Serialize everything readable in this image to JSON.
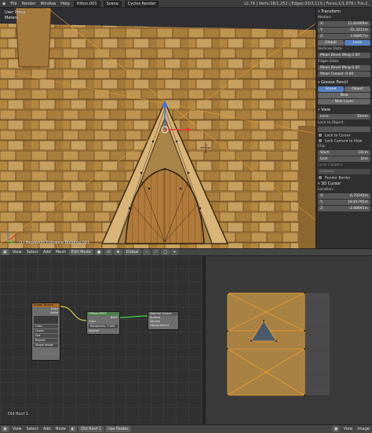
{
  "topbar": {
    "menus": [
      "File",
      "Render",
      "Window",
      "Help"
    ],
    "screen": "Hilton.001",
    "scene": "Scene",
    "engine": "Cycles Render",
    "stats": "v2.76 | Verts:18/1,252 | Edges:30/3,110 | Faces:1/1,878 | Tris:2,"
  },
  "viewport": {
    "view_label": "User Persp",
    "meters_label": "Meters",
    "object_info": "(1) Hepworth Entrance Building.001"
  },
  "npanel": {
    "transform_header": "Transform",
    "median_label": "Median:",
    "median": [
      {
        "axis": "X:",
        "value": "15.84469m"
      },
      {
        "axis": "Y:",
        "value": "-32.3211m"
      },
      {
        "axis": "Z:",
        "value": "3.98857m"
      }
    ],
    "global_btn": "Global",
    "local_btn": "Local",
    "vertices_data": "Vertices Data:",
    "mean_bevel_weight": "Mean Bevel Weig 0.00",
    "edges_data": "Edges Data:",
    "edge_bevel_weight": "Mean Bevel Weig 0.00",
    "mean_crease": "Mean Crease: 0.00",
    "grease_pencil_header": "Grease Pencil",
    "scene_btn": "Scene",
    "object_btn": "Object",
    "new_btn": "New",
    "new_layer_btn": "New Layer",
    "view_header": "View",
    "lens_label": "Lens:",
    "lens_value": "35mm",
    "lock_to_object": "Lock to Object:",
    "lock_to_cursor": "Lock to Cursor",
    "lock_camera_to_view": "Lock Camera to View",
    "clip_label": "Clip:",
    "clip_start_label": "Start:",
    "clip_start_value": "10cm",
    "clip_end_label": "End:",
    "clip_end_value": "1km",
    "local_camera": "Local Camera:",
    "camera_field": "Camera",
    "render_border": "Render Border",
    "cursor_header": "3D Cursor",
    "location_label": "Location:",
    "cursor": [
      {
        "axis": "X:",
        "value": "6.70242m"
      },
      {
        "axis": "Y:",
        "value": "18.81795m"
      },
      {
        "axis": "Z:",
        "value": "-2.88691m"
      }
    ]
  },
  "view_header": {
    "items": [
      "View",
      "Select",
      "Add",
      "Mesh"
    ],
    "mode": "Edit Mode",
    "pivot": "Global"
  },
  "nodes": {
    "image_texture": {
      "title": "Image Texture",
      "outputs": [
        "Color",
        "Alpha"
      ],
      "fields": [
        "Color",
        "Linear",
        "Flat",
        "Repeat",
        "Single Image"
      ]
    },
    "diffuse": {
      "title": "Diffuse BSDF",
      "rows": [
        "BSDF",
        "Color",
        "Roughness: 0.000",
        "Normal"
      ]
    },
    "output": {
      "title": "Material Output",
      "rows": [
        "Surface",
        "Volume",
        "Displacement"
      ]
    },
    "material_label": "Old Roof 1"
  },
  "bottom_header": {
    "items": [
      "View",
      "Select",
      "Add",
      "Node"
    ],
    "material": "Old Roof 1",
    "uv_items": [
      "View",
      "Image"
    ],
    "use_nodes": "Use Nodes"
  },
  "colors": {
    "accent": "#5680c2",
    "roof": "#b8893f",
    "node_header": "#a36b2a"
  }
}
